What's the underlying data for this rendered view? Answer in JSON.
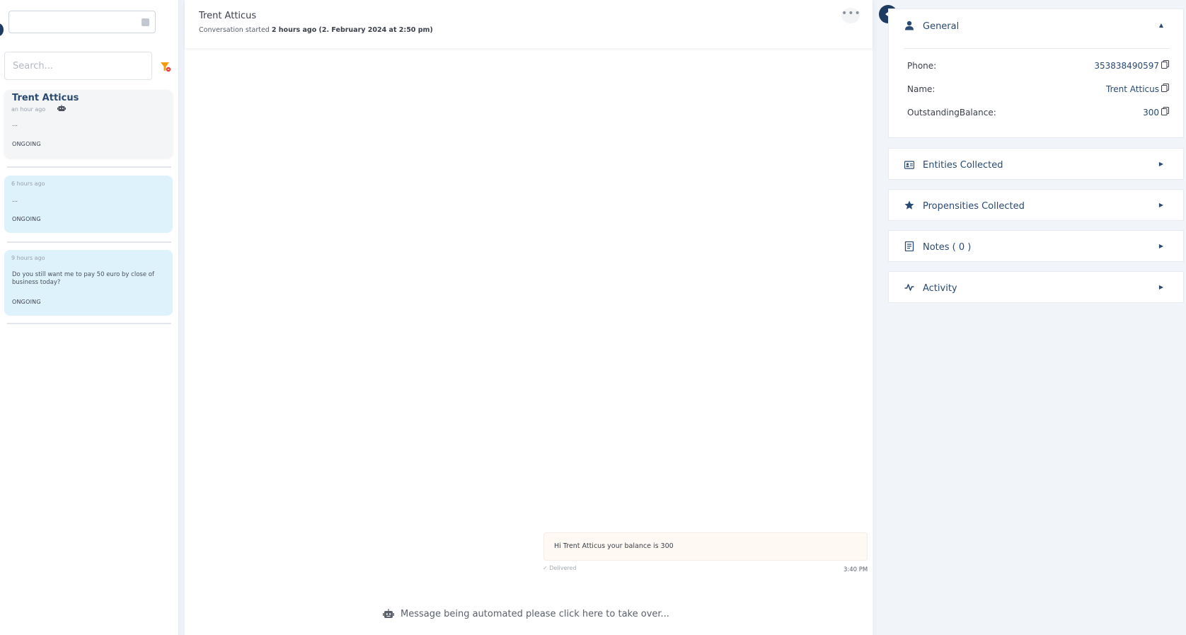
{
  "sidebar": {
    "search_placeholder": "Search...",
    "conversations": [
      {
        "name": "Trent Atticus",
        "time": "an hour ago",
        "preview": "...",
        "status": "ONGOING"
      },
      {
        "name": "",
        "time": "6 hours ago",
        "preview": "...",
        "status": "ONGOING"
      },
      {
        "name": "",
        "time": "9 hours ago",
        "preview": "Do you still want me to pay 50 euro by close of business today?",
        "status": "ONGOING"
      }
    ]
  },
  "chat": {
    "title": "Trent Atticus",
    "subtitle_prefix": "Conversation started ",
    "subtitle_bold": "2 hours ago (2. February 2024 at 2:50 pm)",
    "more_label": "•••",
    "message": {
      "text": "Hi Trent Atticus your balance is 300",
      "status": "Delivered",
      "time": "3:40 PM"
    },
    "takeover": "Message being automated please click here to take over..."
  },
  "details": {
    "general": {
      "title": "General",
      "fields": [
        {
          "label": "Phone:",
          "value": "353838490597"
        },
        {
          "label": "Name:",
          "value": "Trent Atticus"
        },
        {
          "label": "OutstandingBalance:",
          "value": "300"
        }
      ]
    },
    "sections": [
      {
        "title": "Entities Collected",
        "icon": "id-card-icon"
      },
      {
        "title": "Propensities Collected",
        "icon": "star-icon"
      },
      {
        "title": "Notes ( 0 )",
        "icon": "note-icon"
      },
      {
        "title": "Activity",
        "icon": "activity-icon"
      }
    ]
  },
  "colors": {
    "accent": "#1f3b62",
    "active_card": "#f4f5f7",
    "idle_card": "#ddf2fb",
    "filter": "#f59e0b"
  }
}
